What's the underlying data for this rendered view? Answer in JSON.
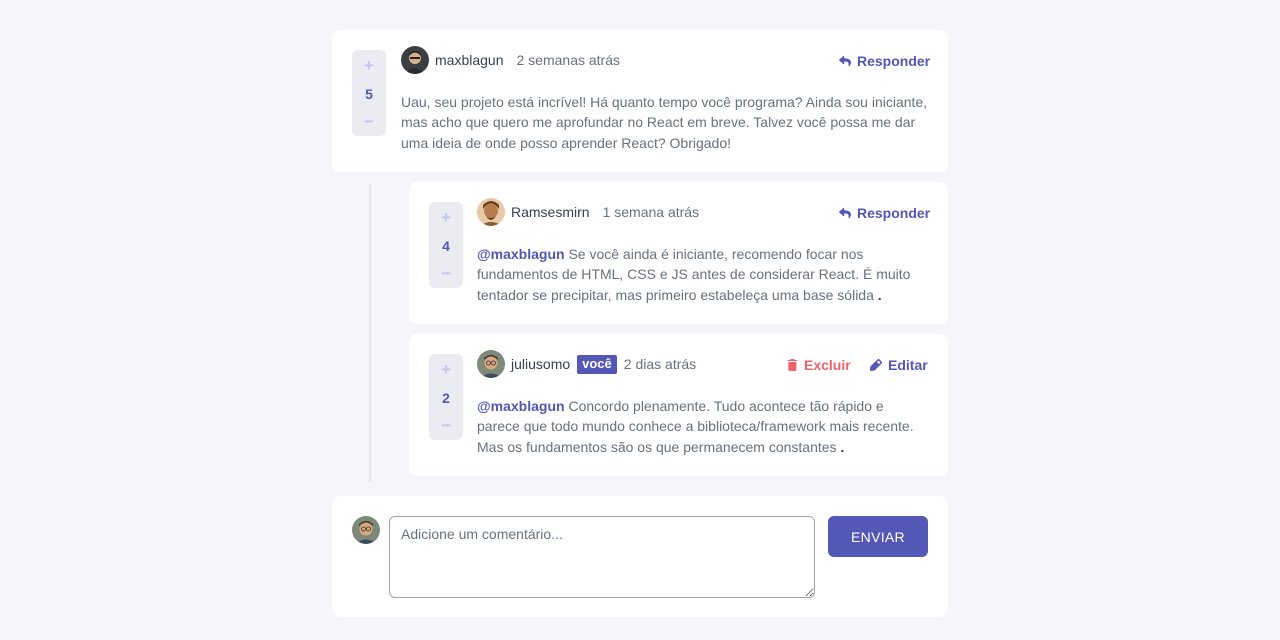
{
  "comments": [
    {
      "username": "maxblagun",
      "time": "2 semanas atrás",
      "score": "5",
      "action_label": "Responder",
      "content": "Uau, seu projeto está incrível! Há quanto tempo você programa? Ainda sou iniciante, mas acho que quero me aprofundar no React em breve. Talvez você possa me dar uma ideia de onde posso aprender React? Obrigado!"
    },
    {
      "username": "Ramsesmirn",
      "time": "1 semana atrás",
      "score": "4",
      "action_label": "Responder",
      "mention": "@maxblagun",
      "content": " Se você ainda é iniciante, recomendo focar nos fundamentos de HTML, CSS e JS antes de considerar React. É muito tentador se precipitar, mas primeiro estabeleça uma base sólida",
      "trailing": " ."
    },
    {
      "username": "juliusomo",
      "you_badge": "você",
      "time": "2 dias atrás",
      "score": "2",
      "delete_label": "Excluir",
      "edit_label": "Editar",
      "mention": "@maxblagun",
      "content": " Concordo plenamente. Tudo acontece tão rápido e parece que todo mundo conhece a biblioteca/framework mais recente. Mas os fundamentos são os que permanecem constantes",
      "trailing": " ."
    }
  ],
  "vote": {
    "plus": "+",
    "minus": "−"
  },
  "composer": {
    "placeholder": "Adicione um comentário...",
    "send_label": "ENVIAR"
  },
  "colors": {
    "accent": "#5357b6",
    "danger": "#ed6368",
    "background": "#f5f6fa",
    "text": "#67727e"
  }
}
